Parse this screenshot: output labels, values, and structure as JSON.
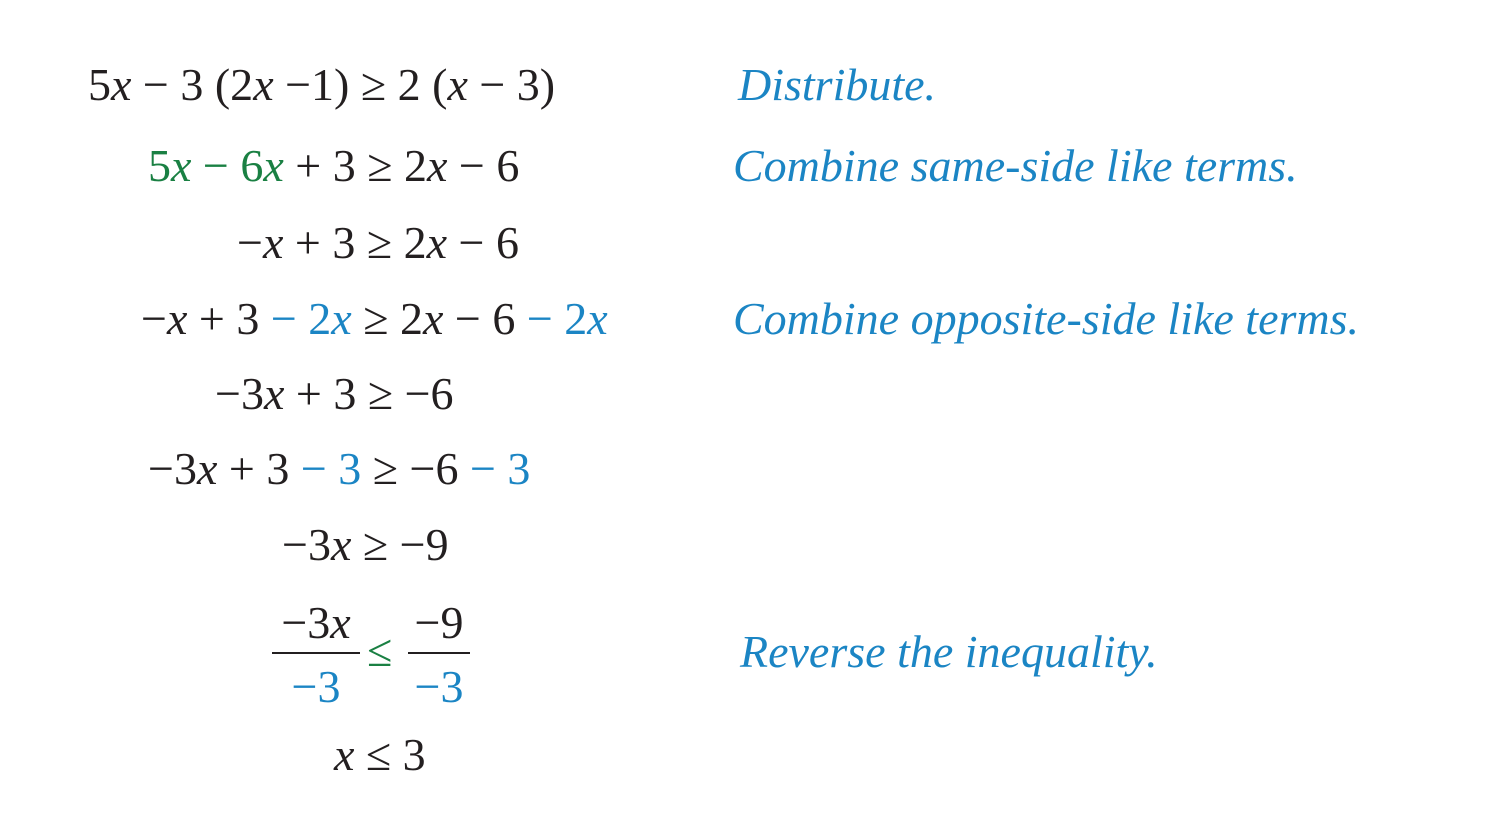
{
  "steps": {
    "s1": {
      "a": "5",
      "b": "x",
      "c": " − 3 (2",
      "d": "x",
      "e": " −1) ≥ 2 (",
      "f": "x",
      "g": " − 3)"
    },
    "s2": {
      "green1": "5",
      "greenx1": "x",
      "green2": " − 6",
      "greenx2": "x",
      "rest": " + 3 ≥ 2",
      "x": "x",
      "tail": " − 6"
    },
    "s3": {
      "a": "−",
      "x1": "x",
      "b": " + 3 ≥ 2",
      "x2": "x",
      "c": " − 6"
    },
    "s4": {
      "a": "−",
      "x1": "x",
      "b": " + 3",
      "blue1": " − 2",
      "bluex1": "x",
      "c": " ≥ 2",
      "x2": "x",
      "d": " − 6",
      "blue2": " − 2",
      "bluex2": "x"
    },
    "s5": {
      "a": "−3",
      "x": "x",
      "b": " + 3 ≥ −6"
    },
    "s6": {
      "a": "−3",
      "x": "x",
      "b": " + 3",
      "blue1": " − 3",
      "c": " ≥ −6",
      "blue2": " − 3"
    },
    "s7": {
      "a": "−3",
      "x": "x",
      "b": " ≥ −9"
    },
    "s8": {
      "left_num": "−3",
      "left_num_x": "x",
      "left_den": "−3",
      "sign": "≤",
      "right_num": "−9",
      "right_den": "−3"
    },
    "s9": {
      "x": "x",
      "b": " ≤ 3"
    }
  },
  "notes": {
    "distribute": "Distribute.",
    "combine_same": "Combine same-side like terms.",
    "combine_opposite": "Combine opposite-side like terms.",
    "reverse": "Reverse the inequality."
  },
  "colors": {
    "text": "#231f20",
    "green": "#1a8043",
    "blue": "#1b85c4"
  }
}
